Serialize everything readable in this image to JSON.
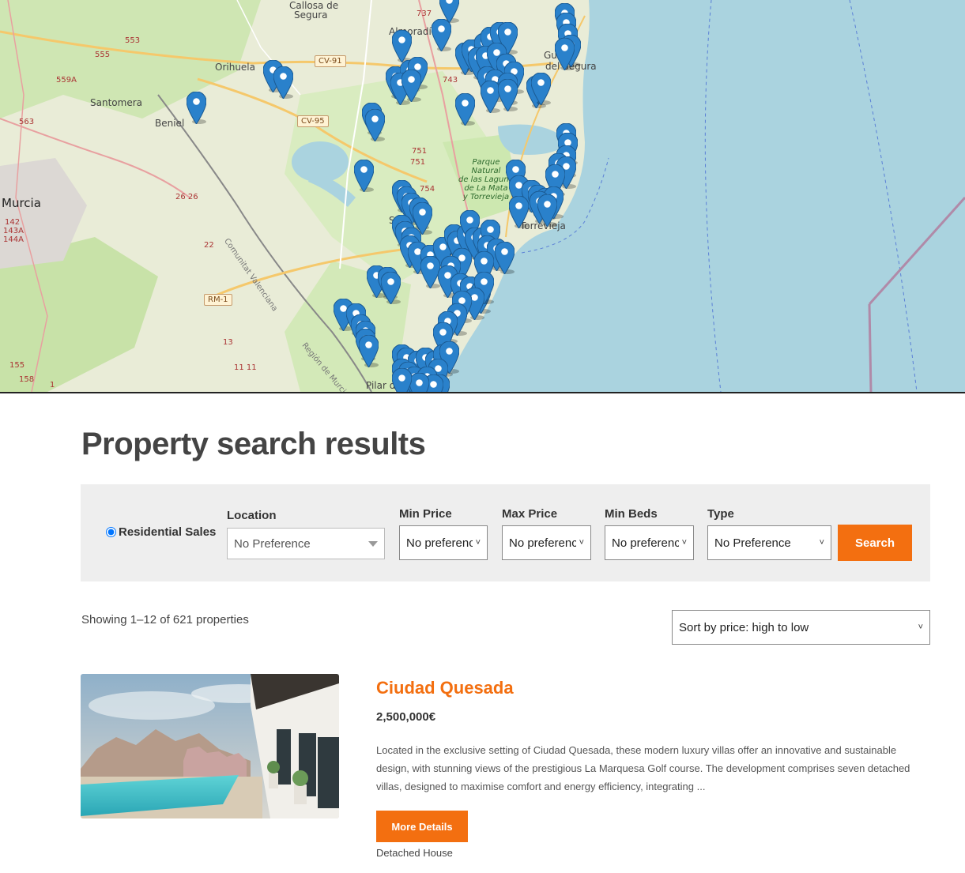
{
  "map": {
    "labels": {
      "callosa": "Callosa de",
      "segura": "Segura",
      "almoradi": "Almoradí",
      "orihuela": "Orihuela",
      "santomera": "Santomera",
      "beniel": "Beniel",
      "murcia": "Murcia",
      "guardamar1": "Gu",
      "guardamar2": "del Segura",
      "torrevieja": "Torrevieja",
      "san_miguel": "San",
      "pilar": "Pilar de",
      "park1": "Parque",
      "park2": "Natural",
      "park3": "de las Lagunas",
      "park4": "de La Mata",
      "park5": "y Torrevieja",
      "comunitat": "Comunitat Valenciana",
      "region_murcia": "Región de Murcia"
    },
    "roads": {
      "cv91": "CV-91",
      "cv95": "CV-95",
      "rm1": "RM-1",
      "r737": "737",
      "r743": "743",
      "r751a": "751",
      "r751b": "751",
      "r754": "754",
      "r553": "553",
      "r555": "555",
      "r559a": "559A",
      "r563": "563",
      "r2626": "26 26",
      "r22": "22",
      "r142": "142",
      "r143a": "143A",
      "r144a": "144A",
      "r155": "155",
      "r158": "158",
      "r13": "13",
      "r1111": "11 11",
      "r1": "1"
    },
    "marker_icon": "map-marker-icon"
  },
  "page": {
    "title": "Property search results"
  },
  "search": {
    "radio_label": "Residential Sales",
    "location_label": "Location",
    "location_value": "No Preference",
    "min_price_label": "Min Price",
    "min_price_value": "No preference",
    "max_price_label": "Max Price",
    "max_price_value": "No preference",
    "min_beds_label": "Min Beds",
    "min_beds_value": "No preference",
    "type_label": "Type",
    "type_value": "No Preference",
    "search_button": "Search"
  },
  "results": {
    "count_text": "Showing 1–12 of 621 properties",
    "sort_value": "Sort by price: high to low"
  },
  "listing": {
    "title": "Ciudad Quesada",
    "price": "2,500,000€",
    "description": "Located in the exclusive setting of Ciudad Quesada, these modern luxury villas offer an innovative and sustainable design, with stunning views of the prestigious La Marquesa Golf course. The development comprises seven detached villas, designed to maximise comfort and energy efficiency, integrating ...",
    "button": "More Details",
    "type": "Detached House"
  },
  "colors": {
    "accent": "#f36f10",
    "marker": "#2a81cb",
    "sea": "#aad3df"
  }
}
